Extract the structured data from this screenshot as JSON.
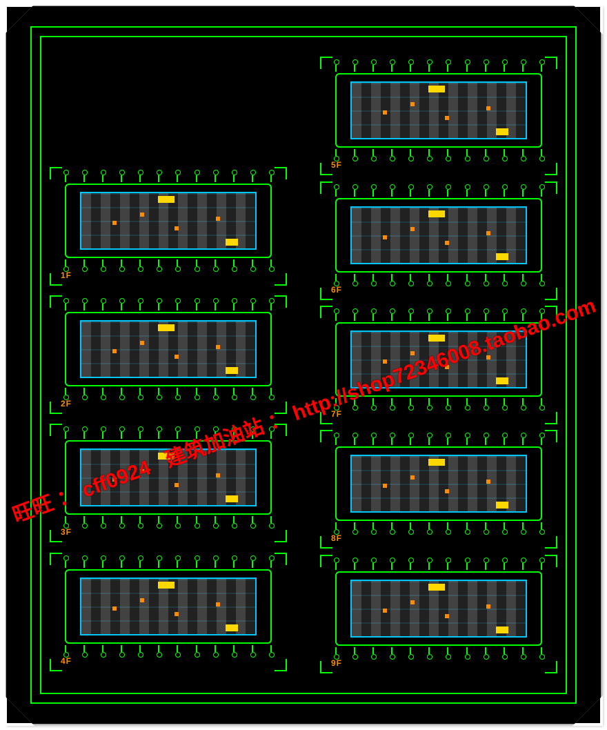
{
  "watermark": {
    "vendor_label": "旺旺",
    "sep": "：",
    "vendor_id": "cff0924",
    "shop_name": "建筑加油站",
    "url": "http://shop72346008.taobao.com"
  },
  "left_column": [
    {
      "label": "1F"
    },
    {
      "label": "2F"
    },
    {
      "label": "3F"
    },
    {
      "label": "4F"
    }
  ],
  "right_column": [
    {
      "label": "5F"
    },
    {
      "label": "6F"
    },
    {
      "label": "7F"
    },
    {
      "label": "8F"
    },
    {
      "label": "9F"
    }
  ],
  "colors": {
    "axis": "#00ff00",
    "wall": "#00c8ff",
    "accent": "#ffd800",
    "label": "#ff8c00",
    "watermark": "#ff0000"
  }
}
